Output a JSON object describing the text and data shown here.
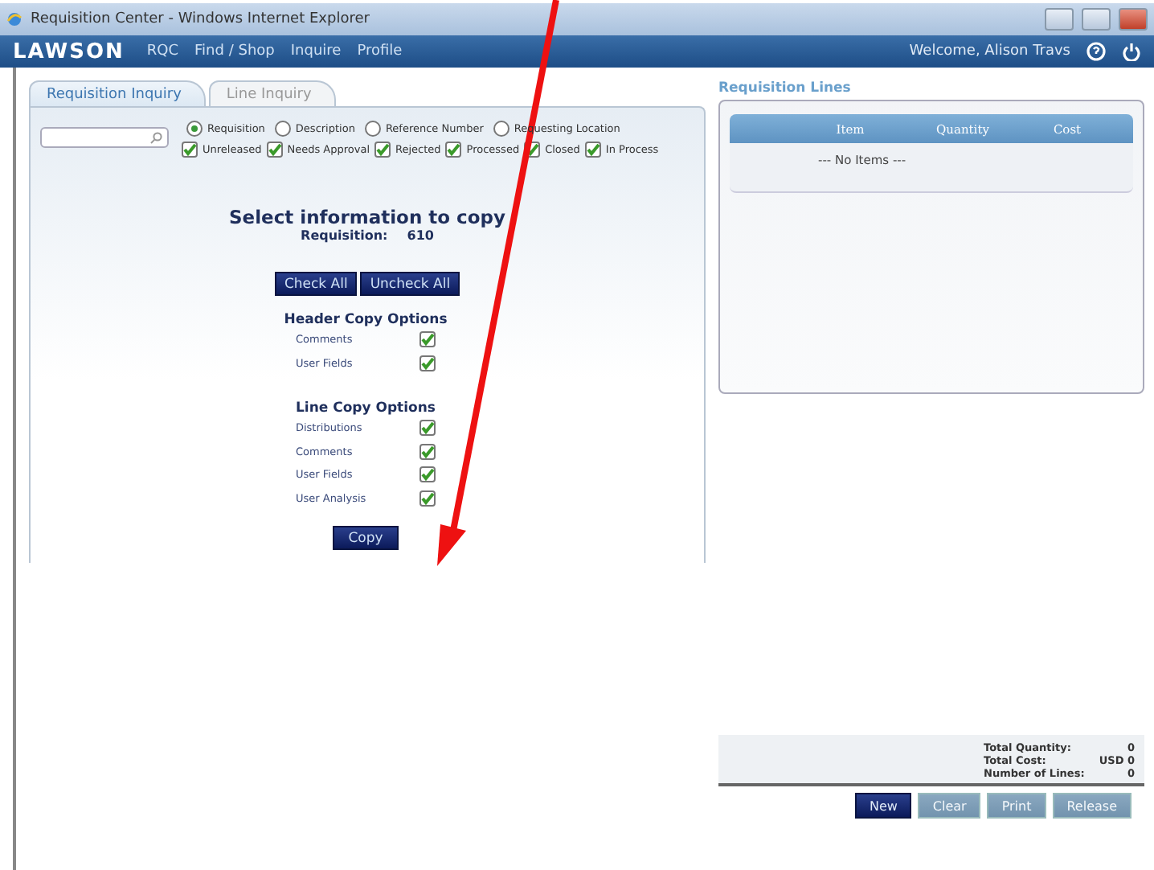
{
  "window": {
    "title": "Requisition Center - Windows Internet Explorer"
  },
  "nav": {
    "logo": "LAWSON",
    "items": [
      "RQC",
      "Find / Shop",
      "Inquire",
      "Profile"
    ],
    "welcome": "Welcome, Alison Travs"
  },
  "tabs": [
    {
      "label": "Requisition Inquiry",
      "selected": true
    },
    {
      "label": "Line Inquiry",
      "selected": false
    }
  ],
  "search_by": [
    {
      "label": "Requisition",
      "selected": true
    },
    {
      "label": "Description",
      "selected": false
    },
    {
      "label": "Reference Number",
      "selected": false
    },
    {
      "label": "Requesting Location",
      "selected": false
    }
  ],
  "statuses": [
    {
      "label": "Unreleased",
      "checked": true
    },
    {
      "label": "Needs Approval",
      "checked": true
    },
    {
      "label": "Rejected",
      "checked": true
    },
    {
      "label": "Processed",
      "checked": true
    },
    {
      "label": "Closed",
      "checked": true
    },
    {
      "label": "In Process",
      "checked": true
    }
  ],
  "copy": {
    "heading": "Select information to copy",
    "requisition_label": "Requisition:",
    "requisition_number": "610",
    "check_all": "Check All",
    "uncheck_all": "Uncheck All",
    "groups": [
      {
        "title": "Header Copy Options",
        "options": [
          {
            "label": "Comments",
            "checked": true
          },
          {
            "label": "User Fields",
            "checked": true
          }
        ]
      },
      {
        "title": "Line Copy Options",
        "options": [
          {
            "label": "Distributions",
            "checked": true
          },
          {
            "label": "Comments",
            "checked": true
          },
          {
            "label": "User Fields",
            "checked": true
          },
          {
            "label": "User Analysis",
            "checked": true
          }
        ]
      }
    ],
    "button": "Copy"
  },
  "lines": {
    "title": "Requisition Lines",
    "columns": [
      "Item",
      "Quantity",
      "Cost"
    ],
    "empty": "--- No Items ---"
  },
  "totals": [
    {
      "label": "Total Quantity:",
      "value": "0"
    },
    {
      "label": "Total Cost:",
      "value": "USD 0"
    },
    {
      "label": "Number of Lines:",
      "value": "0"
    }
  ],
  "actions": [
    {
      "label": "New",
      "disabled": false
    },
    {
      "label": "Clear",
      "disabled": true
    },
    {
      "label": "Print",
      "disabled": true
    },
    {
      "label": "Release",
      "disabled": true
    }
  ]
}
